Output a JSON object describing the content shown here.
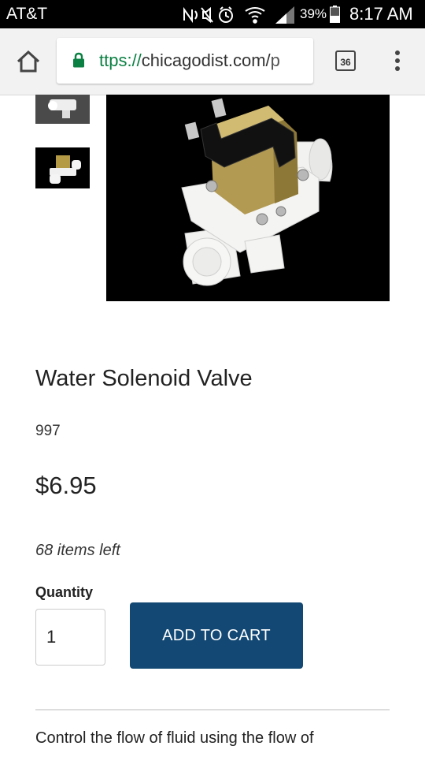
{
  "status_bar": {
    "carrier": "AT&T",
    "battery_percent": "39%",
    "time": "8:17 AM",
    "icons": [
      "nfc-icon",
      "mute-icon",
      "alarm-icon",
      "wifi-icon",
      "signal-icon",
      "battery-icon"
    ]
  },
  "browser": {
    "url_scheme": "ttps://",
    "url_host": "chicagodist.com/",
    "url_rest": "p",
    "tab_count": "36",
    "icons": [
      "home-icon",
      "lock-icon",
      "tabs-icon",
      "overflow-menu-icon"
    ]
  },
  "product": {
    "title": "Water Solenoid Valve",
    "sku": "997",
    "price": "$6.95",
    "stock": "68 items left",
    "quantity_label": "Quantity",
    "quantity_value": "1",
    "add_to_cart_label": "ADD TO CART",
    "description": "Control the flow of fluid using the flow of"
  },
  "colors": {
    "accent_button": "#124873",
    "secure_green": "#0b8043"
  }
}
